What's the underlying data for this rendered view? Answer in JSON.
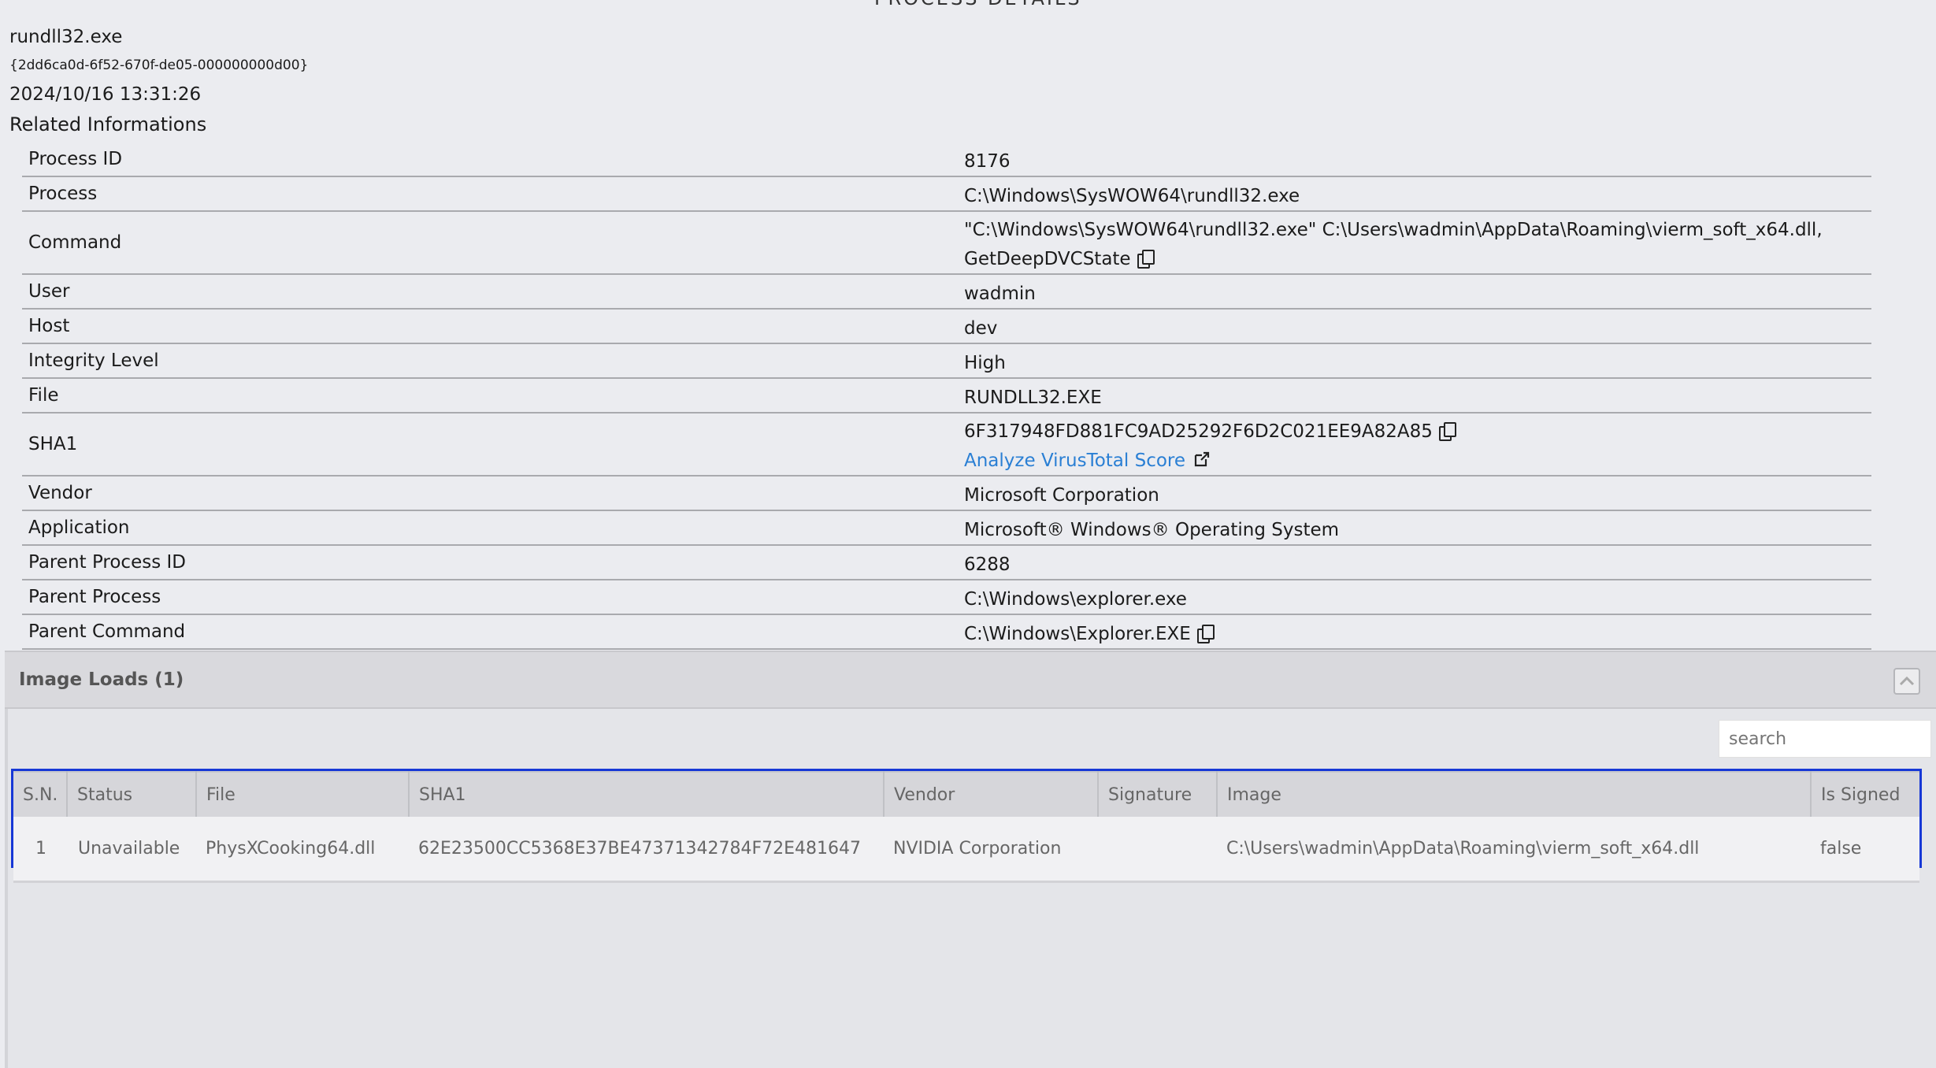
{
  "page": {
    "title_partial": "PROCESS DETAILS"
  },
  "header": {
    "process_name": "rundll32.exe",
    "guid": "{2dd6ca0d-6f52-670f-de05-000000000d00}",
    "timestamp": "2024/10/16 13:31:26",
    "related_title": "Related Informations"
  },
  "info": {
    "process_id": {
      "key": "Process ID",
      "value": "8176"
    },
    "process": {
      "key": "Process",
      "value": "C:\\Windows\\SysWOW64\\rundll32.exe"
    },
    "command": {
      "key": "Command",
      "value_line1": "\"C:\\Windows\\SysWOW64\\rundll32.exe\" C:\\Users\\wadmin\\AppData\\Roaming\\vierm_soft_x64.dll,",
      "value_line2": "GetDeepDVCState"
    },
    "user": {
      "key": "User",
      "value": "wadmin"
    },
    "host": {
      "key": "Host",
      "value": "dev"
    },
    "integrity": {
      "key": "Integrity Level",
      "value": "High"
    },
    "file": {
      "key": "File",
      "value": "RUNDLL32.EXE"
    },
    "sha1": {
      "key": "SHA1",
      "value": "6F317948FD881FC9AD25292F6D2C021EE9A82A85",
      "link": "Analyze VirusTotal Score"
    },
    "vendor": {
      "key": "Vendor",
      "value": "Microsoft Corporation"
    },
    "application": {
      "key": "Application",
      "value": "Microsoft® Windows® Operating System"
    },
    "parent_pid": {
      "key": "Parent Process ID",
      "value": "6288"
    },
    "parent_process": {
      "key": "Parent Process",
      "value": "C:\\Windows\\explorer.exe"
    },
    "parent_command": {
      "key": "Parent Command",
      "value": "C:\\Windows\\Explorer.EXE"
    }
  },
  "image_loads": {
    "title": "Image Loads (1)",
    "search_placeholder": "search",
    "columns": [
      "S.N.",
      "Status",
      "File",
      "SHA1",
      "Vendor",
      "Signature",
      "Image",
      "Is Signed"
    ],
    "rows": [
      [
        "1",
        "Unavailable",
        "PhysXCooking64.dll",
        "62E23500CC5368E37BE47371342784F72E481647",
        "NVIDIA Corporation",
        "",
        "C:\\Users\\wadmin\\AppData\\Roaming\\vierm_soft_x64.dll",
        "false"
      ]
    ]
  }
}
